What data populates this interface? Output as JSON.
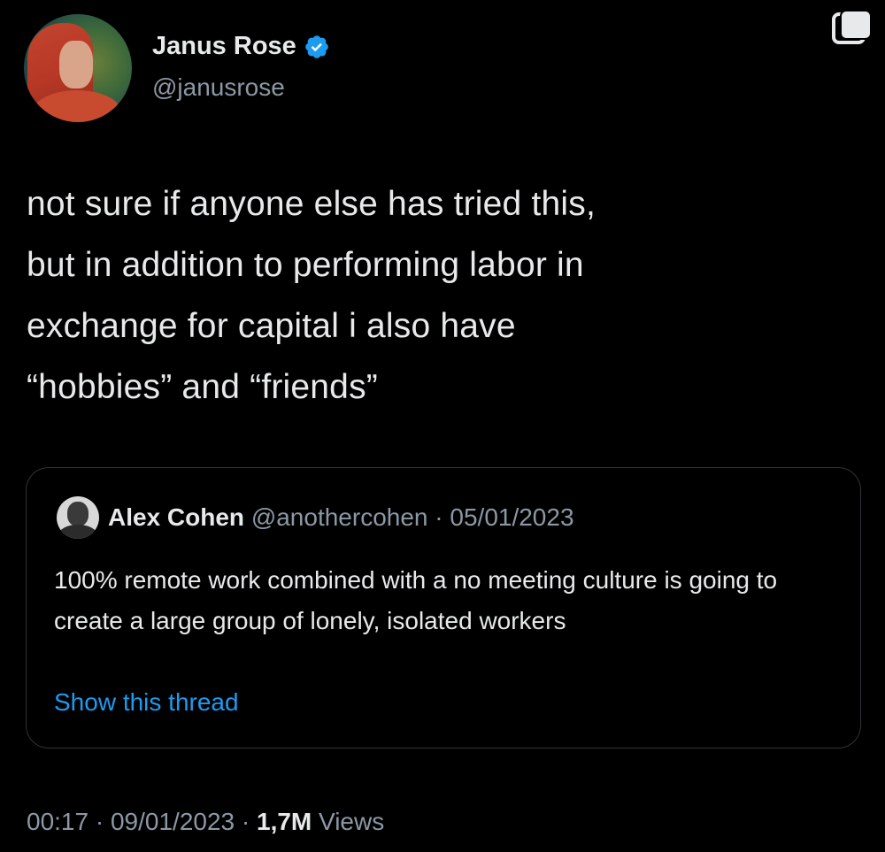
{
  "tweet": {
    "author": {
      "name": "Janus Rose",
      "handle": "@janusrose",
      "verified": true
    },
    "text": "not sure if anyone else has tried this,\nbut in addition to performing labor in\nexchange for capital i also have\n“hobbies” and “friends”",
    "quoted": {
      "name": "Alex Cohen",
      "handle": "@anothercohen",
      "separator": " · ",
      "date": "05/01/2023",
      "text": "100% remote work combined with a no meeting culture is going to create a large group of lonely, isolated workers",
      "show_thread": "Show this thread"
    },
    "footer": {
      "time": "00:17",
      "sep1": " · ",
      "date": "09/01/2023",
      "sep2": " · ",
      "views_count": "1,7M",
      "views_label": " Views"
    }
  },
  "colors": {
    "background": "#000000",
    "text": "#e7e9ea",
    "secondary": "#8b98a5",
    "link": "#1d9bf0",
    "verified": "#1d9bf0",
    "border": "#2f3336"
  },
  "icons": {
    "verified": "verified-badge-icon",
    "copy": "copy-icon"
  }
}
